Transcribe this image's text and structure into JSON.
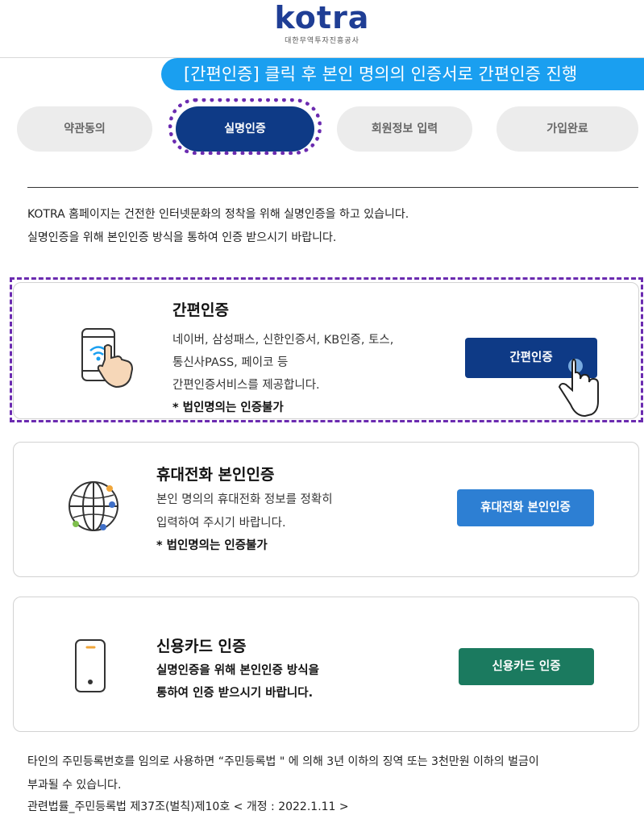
{
  "logo": {
    "name": "kotra",
    "subtitle": "대한무역투자진흥공사"
  },
  "banner": {
    "text": "[간편인증] 클릭 후 본인 명의의 인증서로 간편인증 진행"
  },
  "steps": [
    {
      "label": "약관동의"
    },
    {
      "label": "실명인증"
    },
    {
      "label": "회원정보 입력"
    },
    {
      "label": "가입완료"
    }
  ],
  "intro": {
    "line1": "KOTRA 홈페이지는 건전한 인터넷문화의 정착을 위해 실명인증을 하고 있습니다.",
    "line2": "실명인증을 위해 본인인증 방식을 통하여 인증 받으시기 바랍니다."
  },
  "methods": [
    {
      "title": "간편인증",
      "lines": [
        "네이버, 삼성패스, 신한인증서, KB인증, 토스,",
        "통신사PASS, 페이코 등",
        "간편인증서비스를 제공합니다."
      ],
      "note": "* 법인명의는 인증불가",
      "button": "간편인증",
      "icon": "tap-phone-icon",
      "button_color": "#0e3a86"
    },
    {
      "title": "휴대전화 본인인증",
      "lines": [
        "본인 명의의 휴대전화 정보를 정확히",
        "입력하여 주시기 바랍니다."
      ],
      "note": "* 법인명의는 인증불가",
      "button": "휴대전화 본인인증",
      "icon": "globe-network-icon",
      "button_color": "#2d7fd3"
    },
    {
      "title": "신용카드 인증",
      "lines": [
        "실명인증을 위해 본인인증 방식을",
        "통하여 인증 받으시기 바랍니다."
      ],
      "note": "",
      "button": "신용카드 인증",
      "icon": "mobile-phone-icon",
      "button_color": "#1b7a5f"
    }
  ],
  "footer": {
    "line1": "타인의 주민등록번호를 임의로 사용하면 “주민등록법 \" 에 의해 3년 이하의 징역 또는 3천만원 이하의 벌금이",
    "line2": "부과될 수 있습니다.",
    "line3": "관련법률_주민등록법 제37조(벌칙)제10호 < 개정 : 2022.1.11 >"
  },
  "colors": {
    "accent": "#1a9ff0",
    "primary": "#0e3a86",
    "highlight": "#6b2bb0"
  }
}
